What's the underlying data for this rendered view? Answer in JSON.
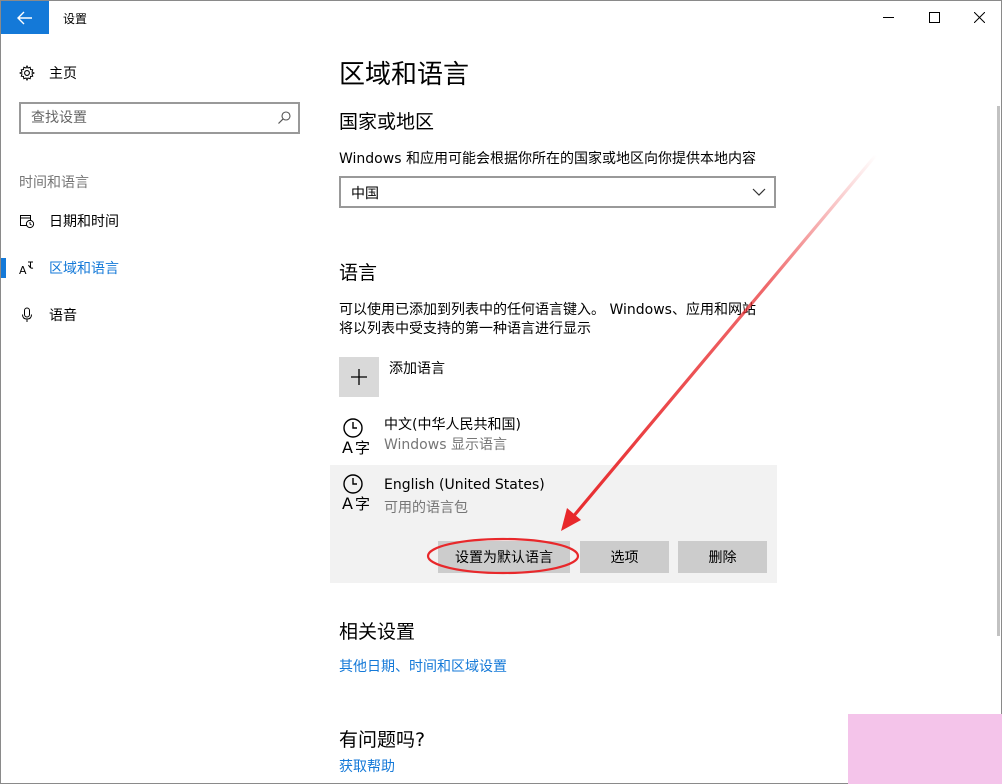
{
  "window": {
    "title": "设置"
  },
  "sidebar": {
    "home_label": "主页",
    "search_placeholder": "查找设置",
    "section_label": "时间和语言",
    "items": [
      {
        "label": "日期和时间",
        "icon": "calendar-clock-icon"
      },
      {
        "label": "区域和语言",
        "icon": "region-language-icon",
        "active": true
      },
      {
        "label": "语音",
        "icon": "microphone-icon"
      }
    ]
  },
  "main": {
    "title": "区域和语言",
    "country": {
      "heading": "国家或地区",
      "description": "Windows 和应用可能会根据你所在的国家或地区向你提供本地内容",
      "selected": "中国"
    },
    "language": {
      "heading": "语言",
      "description_line1": "可以使用已添加到列表中的任何语言键入。 Windows、应用和网站",
      "description_line2": "将以列表中受支持的第一种语言进行显示",
      "add_label": "添加语言",
      "items": [
        {
          "name": "中文(中华人民共和国)",
          "sub": "Windows 显示语言"
        },
        {
          "name": "English (United States)",
          "sub": "可用的语言包"
        }
      ],
      "buttons": {
        "set_default": "设置为默认语言",
        "options": "选项",
        "remove": "删除"
      }
    },
    "related": {
      "heading": "相关设置",
      "link": "其他日期、时间和区域设置"
    },
    "help": {
      "heading": "有问题吗?",
      "link": "获取帮助"
    }
  },
  "colors": {
    "accent": "#1479d8",
    "annotation": "#e8282b",
    "button_bg": "#cccccc",
    "selected_bg": "#f2f2f2"
  }
}
